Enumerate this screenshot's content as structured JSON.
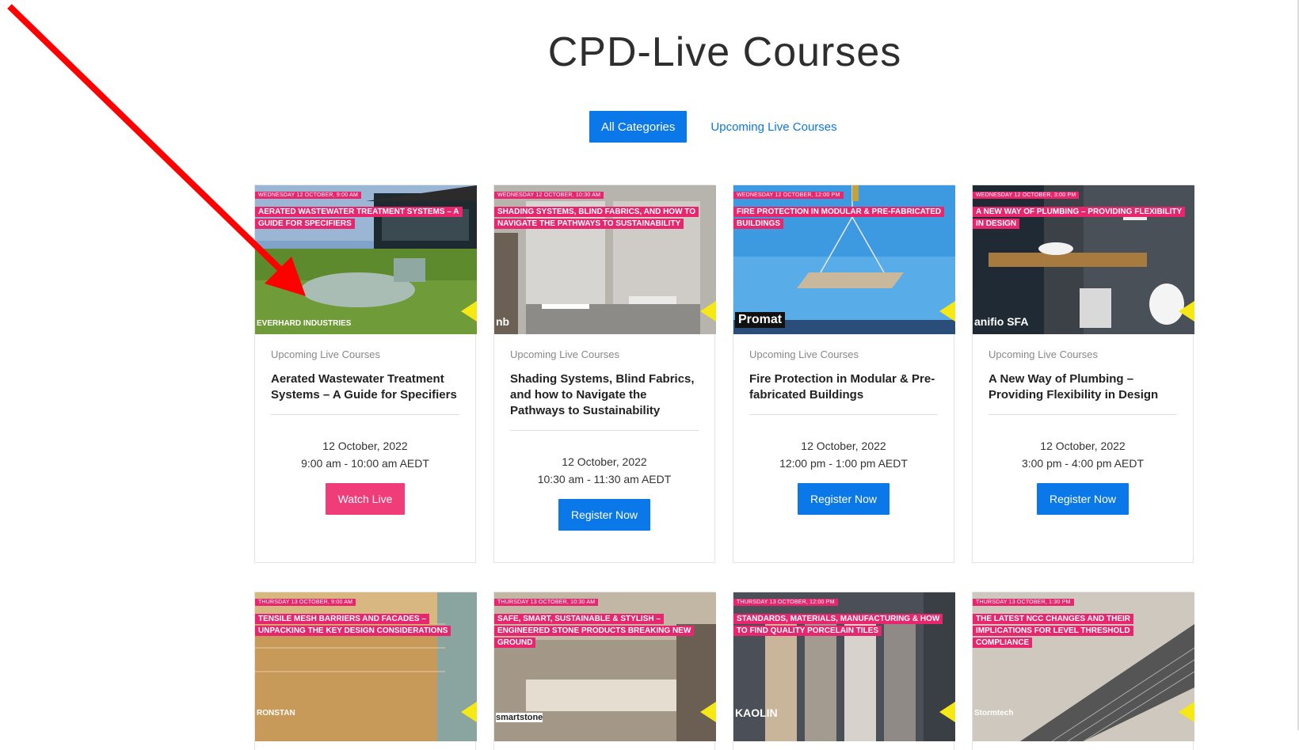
{
  "page": {
    "title": "CPD-Live Courses"
  },
  "filters": {
    "all": "All Categories",
    "upcoming": "Upcoming Live Courses"
  },
  "colors": {
    "accent_blue": "#0b78ea",
    "accent_pink": "#f03d7a",
    "tag_pink": "#e8266e",
    "arrow_red": "#ff0000"
  },
  "cards": [
    {
      "date_tag": "WEDNESDAY 12 OCTOBER, 9:00 AM",
      "tag_title": "AERATED WASTEWATER TREATMENT SYSTEMS – A GUIDE FOR SPECIFIERS",
      "logo": "EVERHARD INDUSTRIES",
      "category": "Upcoming Live Courses",
      "title": "Aerated Wastewater Treatment Systems – A Guide for Specifiers",
      "date": "12 October, 2022",
      "time": "9:00 am - 10:00 am AEDT",
      "button": "Watch Live"
    },
    {
      "date_tag": "WEDNESDAY 12 OCTOBER, 10:30 AM",
      "tag_title": "SHADING SYSTEMS, BLIND FABRICS, AND HOW TO NAVIGATE THE PATHWAYS TO SUSTAINABILITY",
      "logo": "nb",
      "category": "Upcoming Live Courses",
      "title": "Shading Systems, Blind Fabrics, and how to Navigate the Pathways to Sustainability",
      "date": "12 October, 2022",
      "time": "10:30 am - 11:30 am AEDT",
      "button": "Register Now"
    },
    {
      "date_tag": "WEDNESDAY 12 OCTOBER, 12:00 PM",
      "tag_title": "FIRE PROTECTION IN MODULAR & PRE-FABRICATED BUILDINGS",
      "logo": "Promat",
      "category": "Upcoming Live Courses",
      "title": "Fire Protection in Modular & Pre-fabricated Buildings",
      "date": "12 October, 2022",
      "time": "12:00 pm - 1:00 pm AEDT",
      "button": "Register Now"
    },
    {
      "date_tag": "WEDNESDAY 12 OCTOBER, 3:00 PM",
      "tag_title": "A NEW WAY OF PLUMBING – PROVIDING FLEXIBILITY IN DESIGN",
      "logo": "anifio SFA",
      "category": "Upcoming Live Courses",
      "title": "A New Way of Plumbing – Providing Flexibility in Design",
      "date": "12 October, 2022",
      "time": "3:00 pm - 4:00 pm AEDT",
      "button": "Register Now"
    }
  ],
  "cards_row2": [
    {
      "date_tag": "THURSDAY 13 OCTOBER, 9:00 AM",
      "tag_title": "TENSILE MESH BARRIERS AND FACADES – UNPACKING THE KEY DESIGN CONSIDERATIONS",
      "logo": "RONSTAN"
    },
    {
      "date_tag": "THURSDAY 13 OCTOBER, 10:30 AM",
      "tag_title": "SAFE, SMART, SUSTAINABLE & STYLISH – ENGINEERED STONE PRODUCTS BREAKING NEW GROUND",
      "logo": "smartstone"
    },
    {
      "date_tag": "THURSDAY 13 OCTOBER, 12:00 PM",
      "tag_title": "STANDARDS, MATERIALS, MANUFACTURING & HOW TO FIND QUALITY PORCELAIN TILES",
      "logo": "KAOLIN"
    },
    {
      "date_tag": "THURSDAY 13 OCTOBER, 1:30 PM",
      "tag_title": "THE LATEST NCC CHANGES AND THEIR IMPLICATIONS FOR LEVEL THRESHOLD COMPLIANCE",
      "logo": "Stormtech"
    }
  ]
}
